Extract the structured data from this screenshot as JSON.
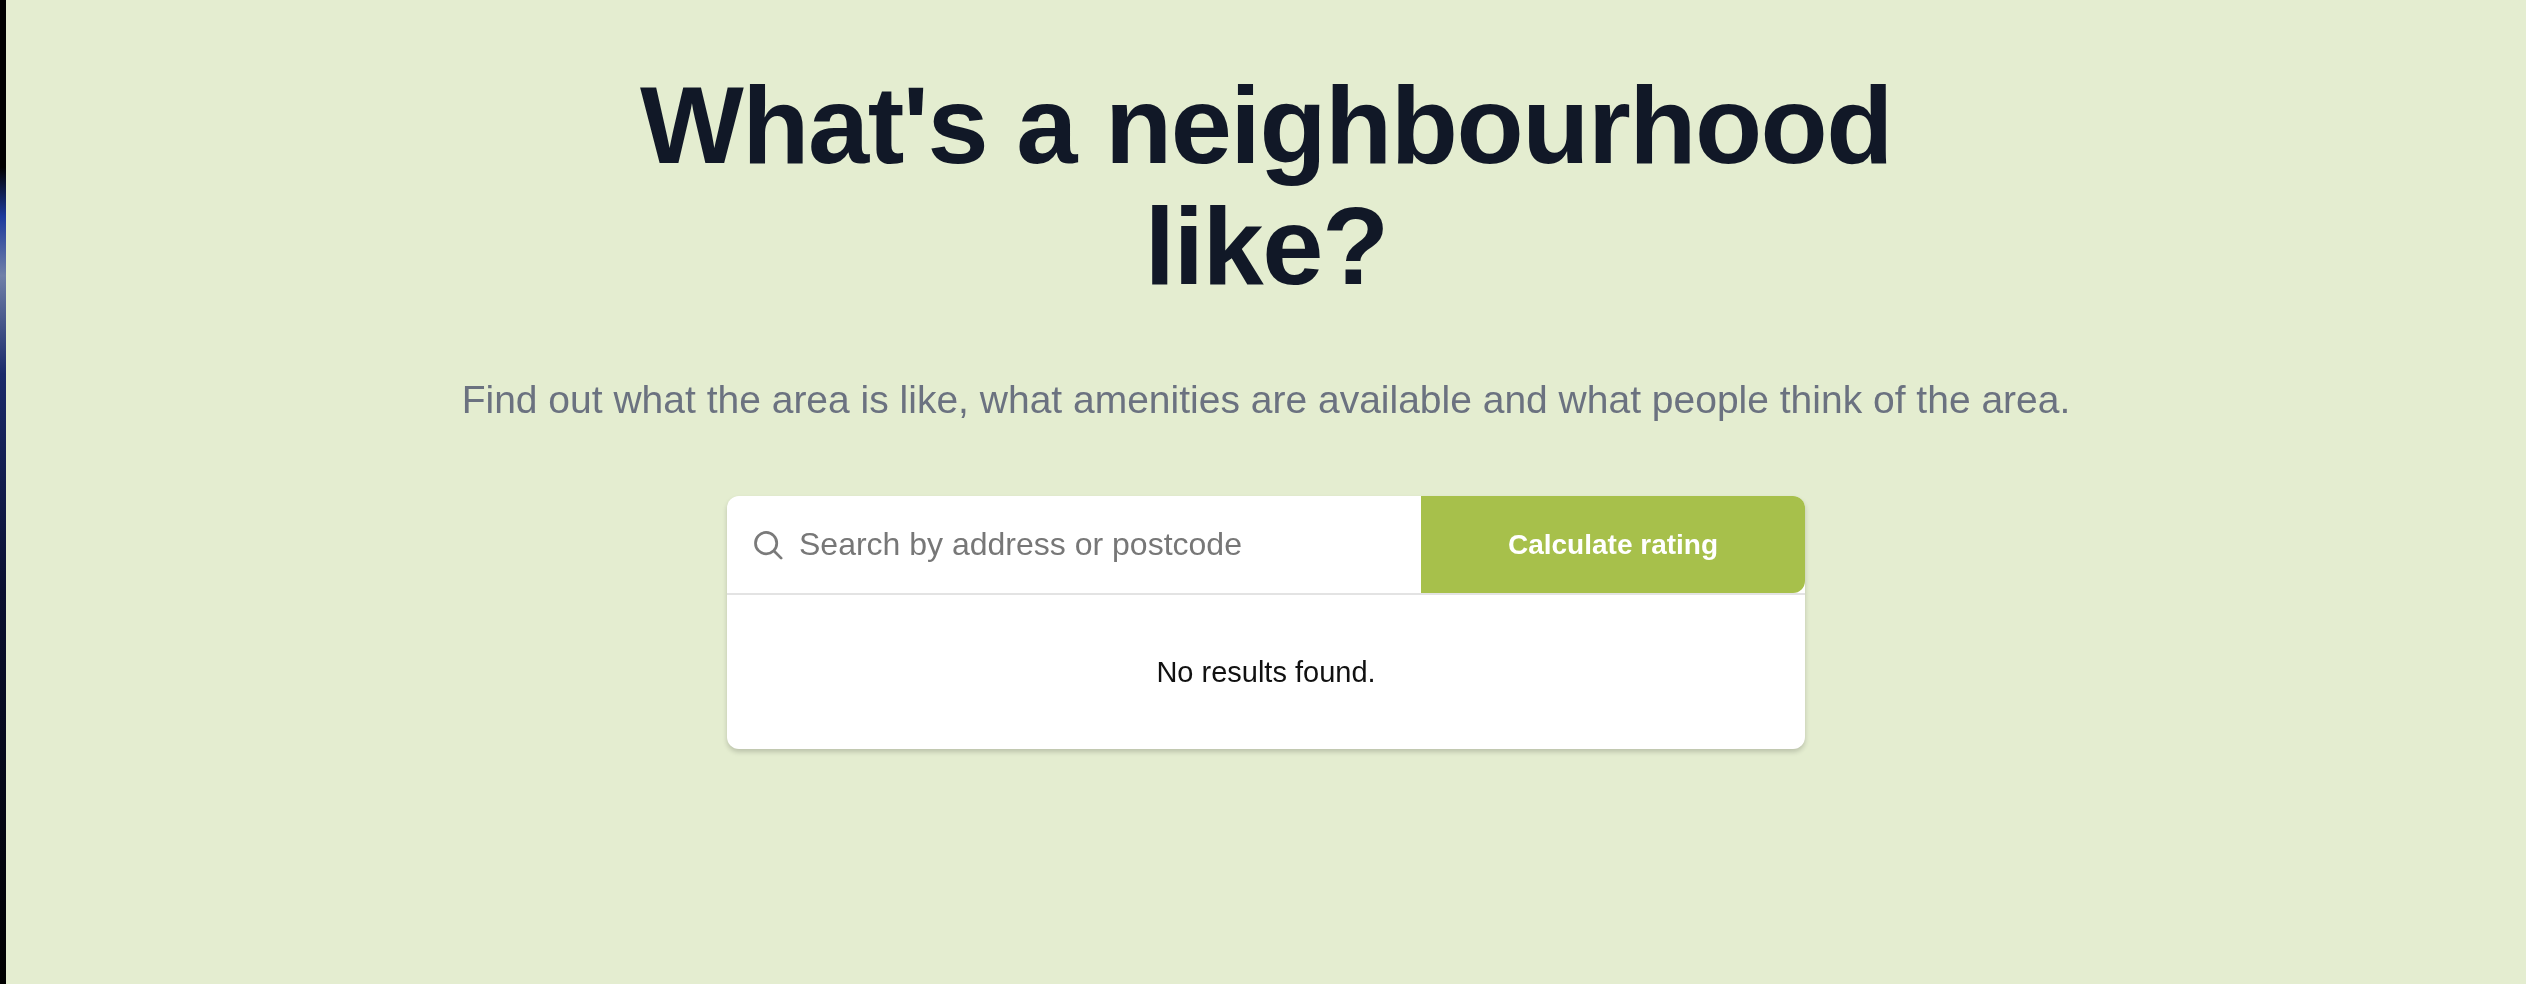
{
  "heading": "What's a neighbourhood like?",
  "subheading": "Find out what the area is like, what amenities are available and what people think of the area.",
  "search": {
    "placeholder": "Search by address or postcode",
    "button": "Calculate rating",
    "results_message": "No results found."
  }
}
